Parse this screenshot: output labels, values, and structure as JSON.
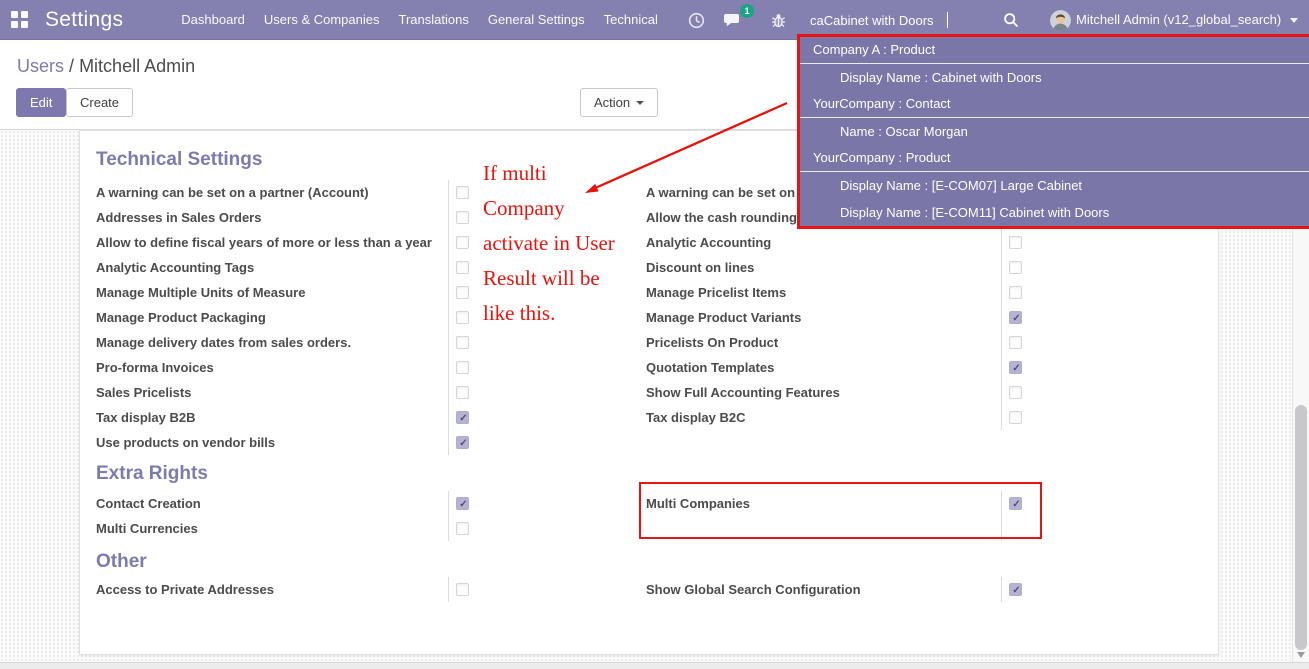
{
  "colors": {
    "navbar": "#8480b0",
    "accent": "#7c7bad",
    "dropdown_bg": "#7a76a8",
    "highlight_red": "#e81313",
    "badge_green": "#1aa385",
    "label_text": "#4b4b4b",
    "annotation_red": "#e8120c"
  },
  "topbar": {
    "app_title": "Settings",
    "menu_items": [
      "Dashboard",
      "Users & Companies",
      "Translations",
      "General Settings",
      "Technical"
    ],
    "icons": [
      "activities-clock-icon",
      "messages-icon",
      "debug-bug-icon",
      "search-icon"
    ],
    "chat_badge": "1",
    "search_value": "caCabinet with Doors",
    "user_name": "Mitchell Admin (v12_global_search)"
  },
  "control_panel": {
    "breadcrumb_parent": "Users",
    "breadcrumb_separator": "/",
    "breadcrumb_current": "Mitchell Admin",
    "edit_label": "Edit",
    "create_label": "Create",
    "action_label": "Action"
  },
  "search_dropdown": {
    "groups": [
      {
        "header": "Company A : Product",
        "items": [
          "Display Name : Cabinet with Doors"
        ]
      },
      {
        "header": "YourCompany : Contact",
        "items": [
          "Name : Oscar Morgan"
        ]
      },
      {
        "header": "YourCompany : Product",
        "items": [
          "Display Name : [E-COM07] Large Cabinet",
          "Display Name : [E-COM11] Cabinet with Doors"
        ]
      }
    ]
  },
  "annotation": {
    "lines": [
      "If multi",
      "Company",
      "activate in User",
      "Result will be",
      "like this."
    ]
  },
  "sections": [
    {
      "title": "Technical Settings",
      "left": [
        {
          "label": "A warning can be set on a partner (Account)",
          "checked": false
        },
        {
          "label": "Addresses in Sales Orders",
          "checked": false
        },
        {
          "label": "Allow to define fiscal years of more or less than a year",
          "checked": false
        },
        {
          "label": "Analytic Accounting Tags",
          "checked": false
        },
        {
          "label": "Manage Multiple Units of Measure",
          "checked": false
        },
        {
          "label": "Manage Product Packaging",
          "checked": false
        },
        {
          "label": "Manage delivery dates from sales orders.",
          "checked": false
        },
        {
          "label": "Pro-forma Invoices",
          "checked": false
        },
        {
          "label": "Sales Pricelists",
          "checked": false
        },
        {
          "label": "Tax display B2B",
          "checked": true
        },
        {
          "label": "Use products on vendor bills",
          "checked": true
        }
      ],
      "right": [
        {
          "label": "A warning can be set on a",
          "checked": false
        },
        {
          "label": "Allow the cash rounding r",
          "checked": false
        },
        {
          "label": "Analytic Accounting",
          "checked": false
        },
        {
          "label": "Discount on lines",
          "checked": false
        },
        {
          "label": "Manage Pricelist Items",
          "checked": false
        },
        {
          "label": "Manage Product Variants",
          "checked": true
        },
        {
          "label": "Pricelists On Product",
          "checked": false
        },
        {
          "label": "Quotation Templates",
          "checked": true
        },
        {
          "label": "Show Full Accounting Features",
          "checked": false
        },
        {
          "label": "Tax display B2C",
          "checked": false
        }
      ]
    },
    {
      "title": "Extra Rights",
      "left": [
        {
          "label": "Contact Creation",
          "checked": true
        },
        {
          "label": "Multi Currencies",
          "checked": false
        }
      ],
      "right": [
        {
          "label": "Multi Companies",
          "checked": true
        },
        {
          "label": "",
          "checked": null
        }
      ]
    },
    {
      "title": "Other",
      "left": [
        {
          "label": "Access to Private Addresses",
          "checked": false
        }
      ],
      "right": [
        {
          "label": "Show Global Search Configuration",
          "checked": true
        }
      ]
    }
  ]
}
